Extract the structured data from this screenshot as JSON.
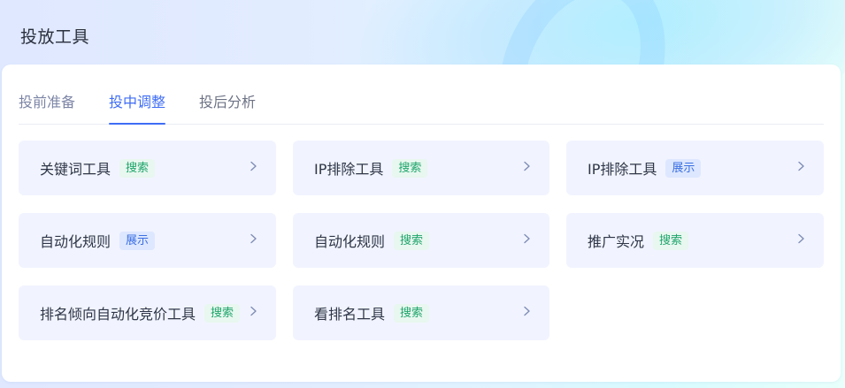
{
  "header": {
    "title": "投放工具"
  },
  "tabs": [
    {
      "label": "投前准备",
      "active": false
    },
    {
      "label": "投中调整",
      "active": true
    },
    {
      "label": "投后分析",
      "active": false
    }
  ],
  "cards": [
    {
      "title": "关键词工具",
      "tag": "搜索",
      "tag_type": "search"
    },
    {
      "title": "IP排除工具",
      "tag": "搜索",
      "tag_type": "search"
    },
    {
      "title": "IP排除工具",
      "tag": "展示",
      "tag_type": "display"
    },
    {
      "title": "自动化规则",
      "tag": "展示",
      "tag_type": "display"
    },
    {
      "title": "自动化规则",
      "tag": "搜索",
      "tag_type": "search"
    },
    {
      "title": "推广实况",
      "tag": "搜索",
      "tag_type": "search"
    },
    {
      "title": "排名倾向自动化竞价工具",
      "tag": "搜索",
      "tag_type": "search"
    },
    {
      "title": "看排名工具",
      "tag": "搜索",
      "tag_type": "search"
    }
  ],
  "colors": {
    "accent": "#3f6df5",
    "search_tag_text": "#1ea56b",
    "search_tag_bg": "#e8f7ef",
    "display_tag_text": "#3a6fe2",
    "display_tag_bg": "#dde7ff",
    "card_bg": "#f1f4ff"
  },
  "icons": {
    "card_arrow": "chevron-right-icon"
  }
}
